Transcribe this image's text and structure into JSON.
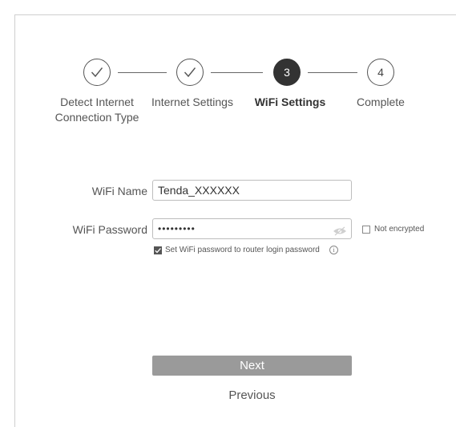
{
  "steps": [
    {
      "label_line1": "Detect Internet",
      "label_line2": "Connection Type",
      "state": "done"
    },
    {
      "label_line1": "Internet Settings",
      "label_line2": "",
      "state": "done"
    },
    {
      "number": "3",
      "label_line1": "WiFi Settings",
      "label_line2": "",
      "state": "active"
    },
    {
      "number": "4",
      "label_line1": "Complete",
      "label_line2": "",
      "state": "pending"
    }
  ],
  "form": {
    "wifi_name_label": "WiFi Name",
    "wifi_name_value": "Tenda_XXXXXX",
    "wifi_password_label": "WiFi Password",
    "wifi_password_value": "•••••••••",
    "not_encrypted_label": "Not encrypted",
    "not_encrypted_checked": false,
    "sync_password_label": "Set WiFi password to router login password",
    "sync_password_checked": true,
    "info_symbol": "i"
  },
  "buttons": {
    "next_label": "Next",
    "previous_label": "Previous"
  },
  "colors": {
    "active_step": "#333333",
    "next_button": "#9a9a9a"
  }
}
